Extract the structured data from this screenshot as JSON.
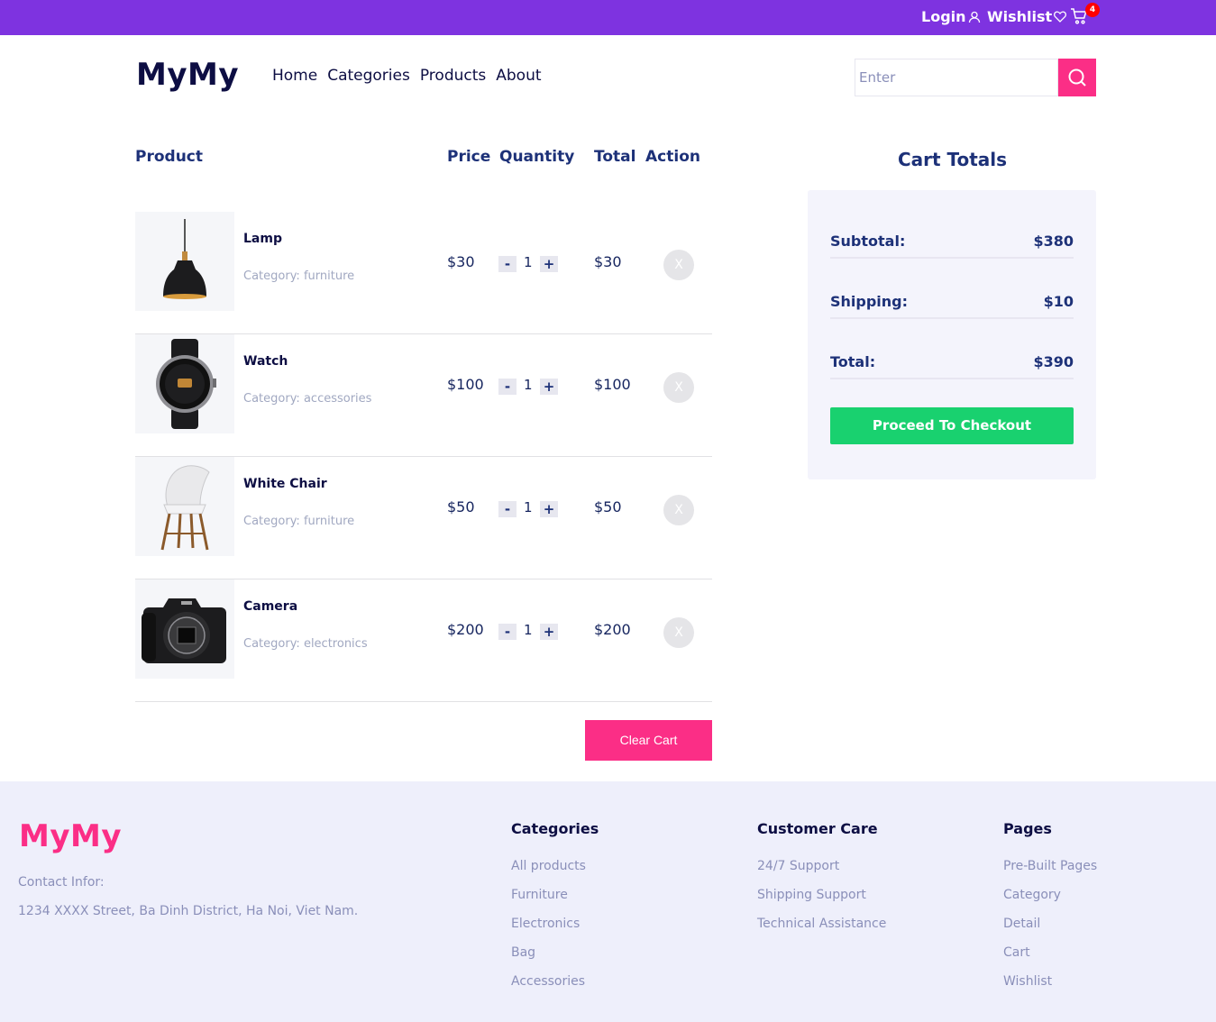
{
  "topbar": {
    "login_label": "Login",
    "wishlist_label": "Wishlist",
    "cart_count": "4"
  },
  "header": {
    "logo": "MyMy",
    "nav": [
      "Home",
      "Categories",
      "Products",
      "About"
    ],
    "search_placeholder": "Enter"
  },
  "table": {
    "headers": {
      "product": "Product",
      "price": "Price",
      "quantity": "Quantity",
      "total": "Total",
      "action": "Action"
    },
    "rows": [
      {
        "name": "Lamp",
        "category": "Category: furniture",
        "price": "$30",
        "quantity": "1",
        "total": "$30",
        "remove": "X",
        "image": "lamp-image"
      },
      {
        "name": "Watch",
        "category": "Category: accessories",
        "price": "$100",
        "quantity": "1",
        "total": "$100",
        "remove": "X",
        "image": "watch-image"
      },
      {
        "name": "White Chair",
        "category": "Category: furniture",
        "price": "$50",
        "quantity": "1",
        "total": "$50",
        "remove": "X",
        "image": "chair-image"
      },
      {
        "name": "Camera",
        "category": "Category: electronics",
        "price": "$200",
        "quantity": "1",
        "total": "$200",
        "remove": "X",
        "image": "camera-image"
      }
    ],
    "qty_minus": "-",
    "qty_plus": "+",
    "clear_label": "Clear Cart"
  },
  "cart_totals": {
    "title": "Cart Totals",
    "subtotal_label": "Subtotal:",
    "subtotal_value": "$380",
    "shipping_label": "Shipping:",
    "shipping_value": "$10",
    "total_label": "Total:",
    "total_value": "$390",
    "checkout_label": "Proceed To Checkout"
  },
  "footer": {
    "logo": "MyMy",
    "contact_label": "Contact Infor:",
    "address": "1234 XXXX Street, Ba Dinh District, Ha Noi, Viet Nam.",
    "columns": [
      {
        "title": "Categories",
        "links": [
          "All products",
          "Furniture",
          "Electronics",
          "Bag",
          "Accessories"
        ]
      },
      {
        "title": "Customer Care",
        "links": [
          "24/7 Support",
          "Shipping Support",
          "Technical Assistance"
        ]
      },
      {
        "title": "Pages",
        "links": [
          "Pre-Built Pages",
          "Category",
          "Detail",
          "Cart",
          "Wishlist"
        ]
      }
    ]
  },
  "colors": {
    "topbar": "#7e33e0",
    "accent_pink": "#fb2e86",
    "checkout_green": "#19d16f",
    "navy": "#1d3178",
    "footer_bg": "#eeeffb"
  }
}
